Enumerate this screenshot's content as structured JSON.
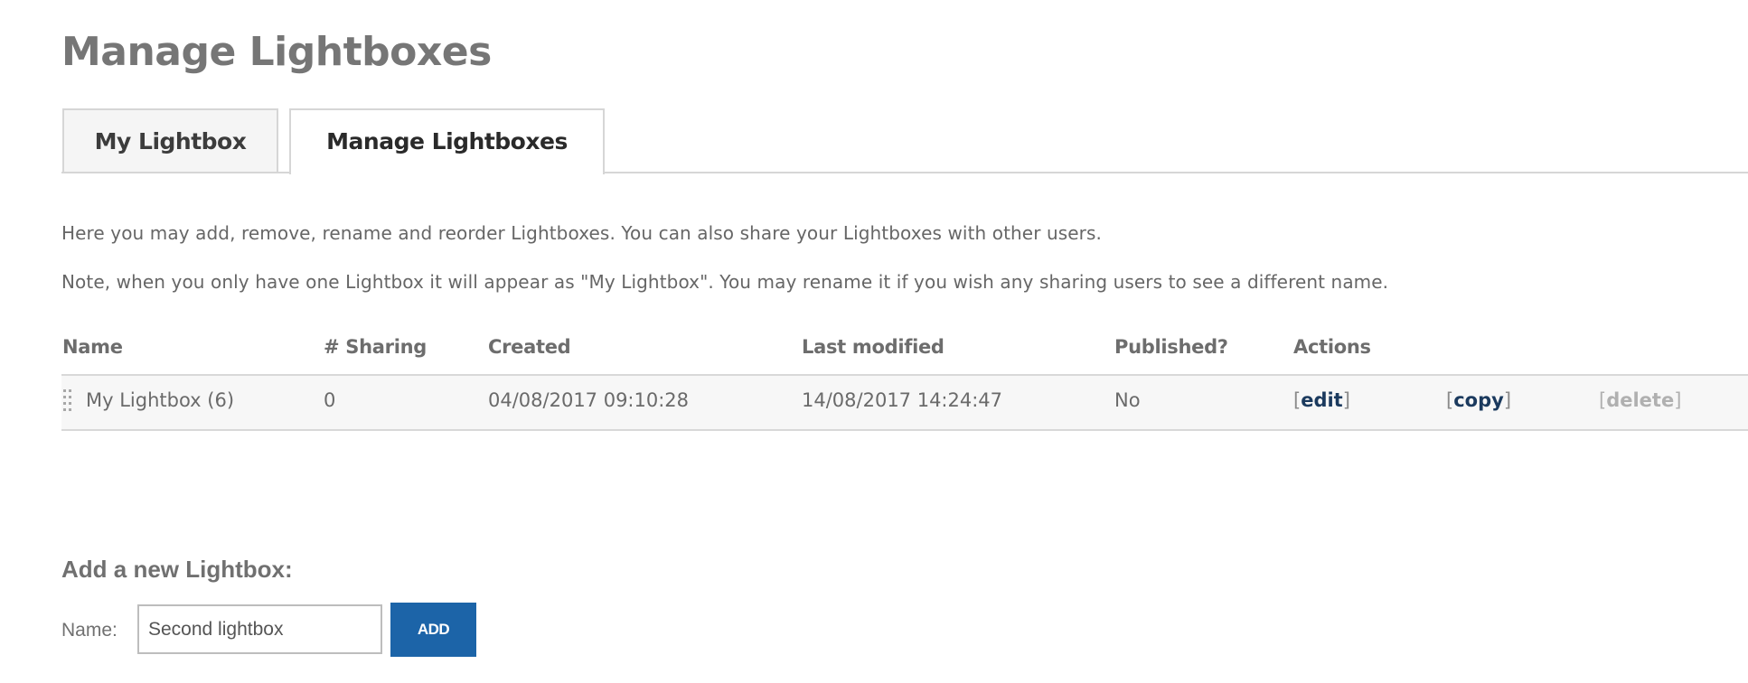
{
  "page": {
    "title": "Manage Lightboxes"
  },
  "tabs": [
    {
      "label": "My Lightbox",
      "active": false
    },
    {
      "label": "Manage Lightboxes",
      "active": true
    }
  ],
  "intro": {
    "line1": "Here you may add, remove, rename and reorder Lightboxes. You can also share your Lightboxes with other users.",
    "line2": "Note, when you only have one Lightbox it will appear as \"My Lightbox\". You may rename it if you wish any sharing users to see a different name."
  },
  "table": {
    "columns": [
      "Name",
      "# Sharing",
      "Created",
      "Last modified",
      "Published?",
      "Actions"
    ],
    "rows": [
      {
        "name": "My Lightbox (6)",
        "sharing": "0",
        "created": "04/08/2017 09:10:28",
        "last_modified": "14/08/2017 14:24:47",
        "published": "No",
        "actions": {
          "edit": "edit",
          "copy": "copy",
          "delete": "delete"
        }
      }
    ],
    "bracket_open": "[",
    "bracket_close": "]"
  },
  "add_form": {
    "heading": "Add a new Lightbox:",
    "name_label": "Name:",
    "name_value": "Second lightbox",
    "add_button": "ADD"
  },
  "colors": {
    "add_button": "#1c64a8",
    "action_link": "#1b3a5e",
    "action_disabled": "#b0b0b0"
  }
}
